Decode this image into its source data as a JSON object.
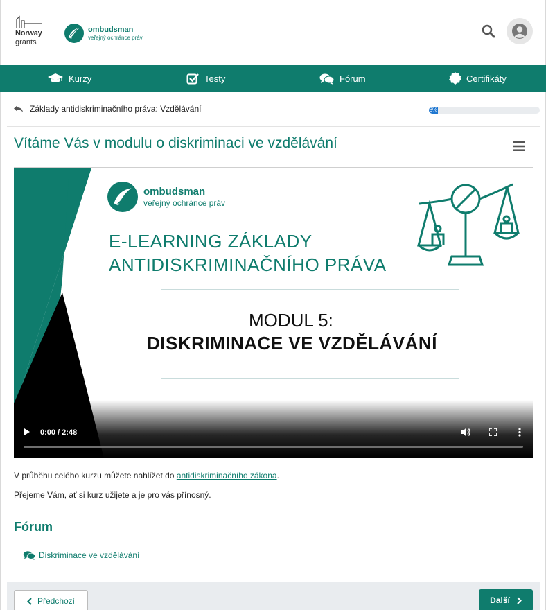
{
  "header": {
    "norway_logo": {
      "line1": "Norway",
      "line2": "grants"
    },
    "ombudsman_logo": {
      "name": "ombudsman",
      "subtitle": "veřejný ochránce práv"
    }
  },
  "nav": {
    "items": [
      {
        "label": "Kurzy",
        "icon": "graduation-cap-icon"
      },
      {
        "label": "Testy",
        "icon": "check-square-icon"
      },
      {
        "label": "Fórum",
        "icon": "comments-icon"
      },
      {
        "label": "Certifikáty",
        "icon": "certificate-icon"
      }
    ]
  },
  "breadcrumb": {
    "text": "Základy antidiskriminačního práva: Vzdělávání"
  },
  "progress": {
    "percent": 8,
    "label": "8%"
  },
  "page": {
    "title": "Vítáme Vás v modulu o diskriminaci ve vzdělávání"
  },
  "video": {
    "time": "0:00 / 2:48",
    "slide": {
      "logo_name": "ombudsman",
      "logo_subtitle": "veřejný ochránce práv",
      "title_line1": "E-LEARNING ZÁKLADY",
      "title_line2": "ANTIDISKRIMINAČNÍHO PRÁVA",
      "module": "MODUL 5:",
      "module_title": "DISKRIMINACE VE VZDĚLÁVÁNÍ"
    }
  },
  "content": {
    "para1_prefix": "V průběhu celého kurzu můžete nahlížet do ",
    "para1_link": "antidiskriminačního zákona",
    "para1_suffix": ".",
    "para2": "Přejeme Vám, ať si kurz užijete a je pro vás přínosný."
  },
  "forum": {
    "heading": "Fórum",
    "link": "Diskriminace ve vzdělávání"
  },
  "footer": {
    "prev_label": "Předchozí",
    "next_label": "Další"
  },
  "colors": {
    "brand": "#0f7c6d",
    "progress": "#1f77d0"
  }
}
